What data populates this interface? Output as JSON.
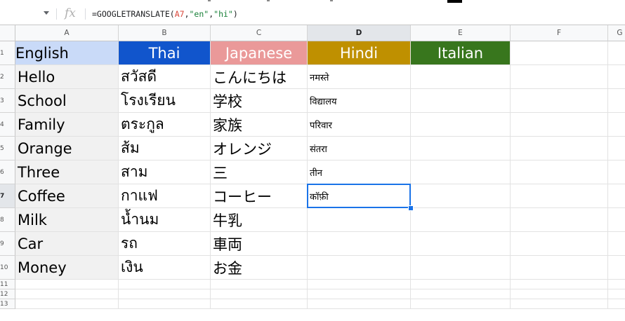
{
  "colors": {
    "english_header": "#c9daf8",
    "thai_header": "#1155cc",
    "japanese_header": "#ea9999",
    "hindi_header": "#bf9000",
    "italian_header": "#38761d",
    "selection": "#1a73e8"
  },
  "formula_bar": {
    "fx_icon": "fx",
    "formula_parts": [
      "=GOOGLETRANSLATE(",
      "A7",
      ",",
      "\"en\"",
      ",",
      "\"hi\"",
      ")"
    ]
  },
  "columns": [
    "A",
    "B",
    "C",
    "D",
    "E",
    "F",
    "G"
  ],
  "active_column": "D",
  "rows": [
    "1",
    "2",
    "3",
    "4",
    "5",
    "6",
    "7",
    "8",
    "9",
    "10",
    "11",
    "12",
    "13"
  ],
  "active_row": "7",
  "headers": {
    "english": "English",
    "thai": "Thai",
    "japanese": "Japanese",
    "hindi": "Hindi",
    "italian": "Italian"
  },
  "table": [
    {
      "english": "Hello",
      "thai": "สวัสดี",
      "japanese": "こんにちは",
      "hindi": "नमस्ते"
    },
    {
      "english": "School",
      "thai": "โรงเรียน",
      "japanese": "学校",
      "hindi": "विद्यालय"
    },
    {
      "english": "Family",
      "thai": "ตระกูล",
      "japanese": "家族",
      "hindi": "परिवार"
    },
    {
      "english": "Orange",
      "thai": "ส้ม",
      "japanese": "オレンジ",
      "hindi": "संतरा"
    },
    {
      "english": "Three",
      "thai": "สาม",
      "japanese": "三",
      "hindi": "तीन"
    },
    {
      "english": "Coffee",
      "thai": "กาแฟ",
      "japanese": "コーヒー",
      "hindi": "कॉफ़ी"
    },
    {
      "english": "Milk",
      "thai": "น้ำนม",
      "japanese": "牛乳",
      "hindi": ""
    },
    {
      "english": "Car",
      "thai": "รถ",
      "japanese": "車両",
      "hindi": ""
    },
    {
      "english": "Money",
      "thai": "เงิน",
      "japanese": "お金",
      "hindi": ""
    }
  ]
}
